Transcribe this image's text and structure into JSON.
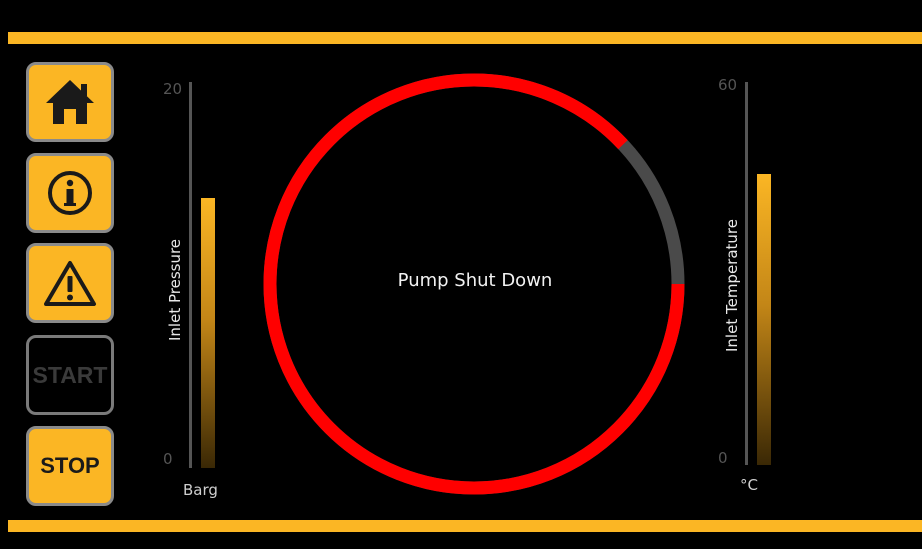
{
  "nav": {
    "home_icon": "home-icon",
    "info_icon": "info-icon",
    "warning_icon": "warning-icon",
    "start_label": "START",
    "stop_label": "STOP",
    "accent_color": "#fbb624"
  },
  "pressure": {
    "label": "Inlet Pressure",
    "max_tick": "20",
    "min_tick": "0",
    "unit": "Barg",
    "value_fraction": 0.7
  },
  "temperature": {
    "label": "Inlet Temperature",
    "max_tick": "60",
    "min_tick": "0",
    "unit": "°C",
    "value_fraction": 0.76
  },
  "pump": {
    "status": "Pump Shut Down",
    "ring_color": "#ff0000",
    "remainder_color": "#4a4a4a",
    "ring_fill_fraction": 0.88
  }
}
